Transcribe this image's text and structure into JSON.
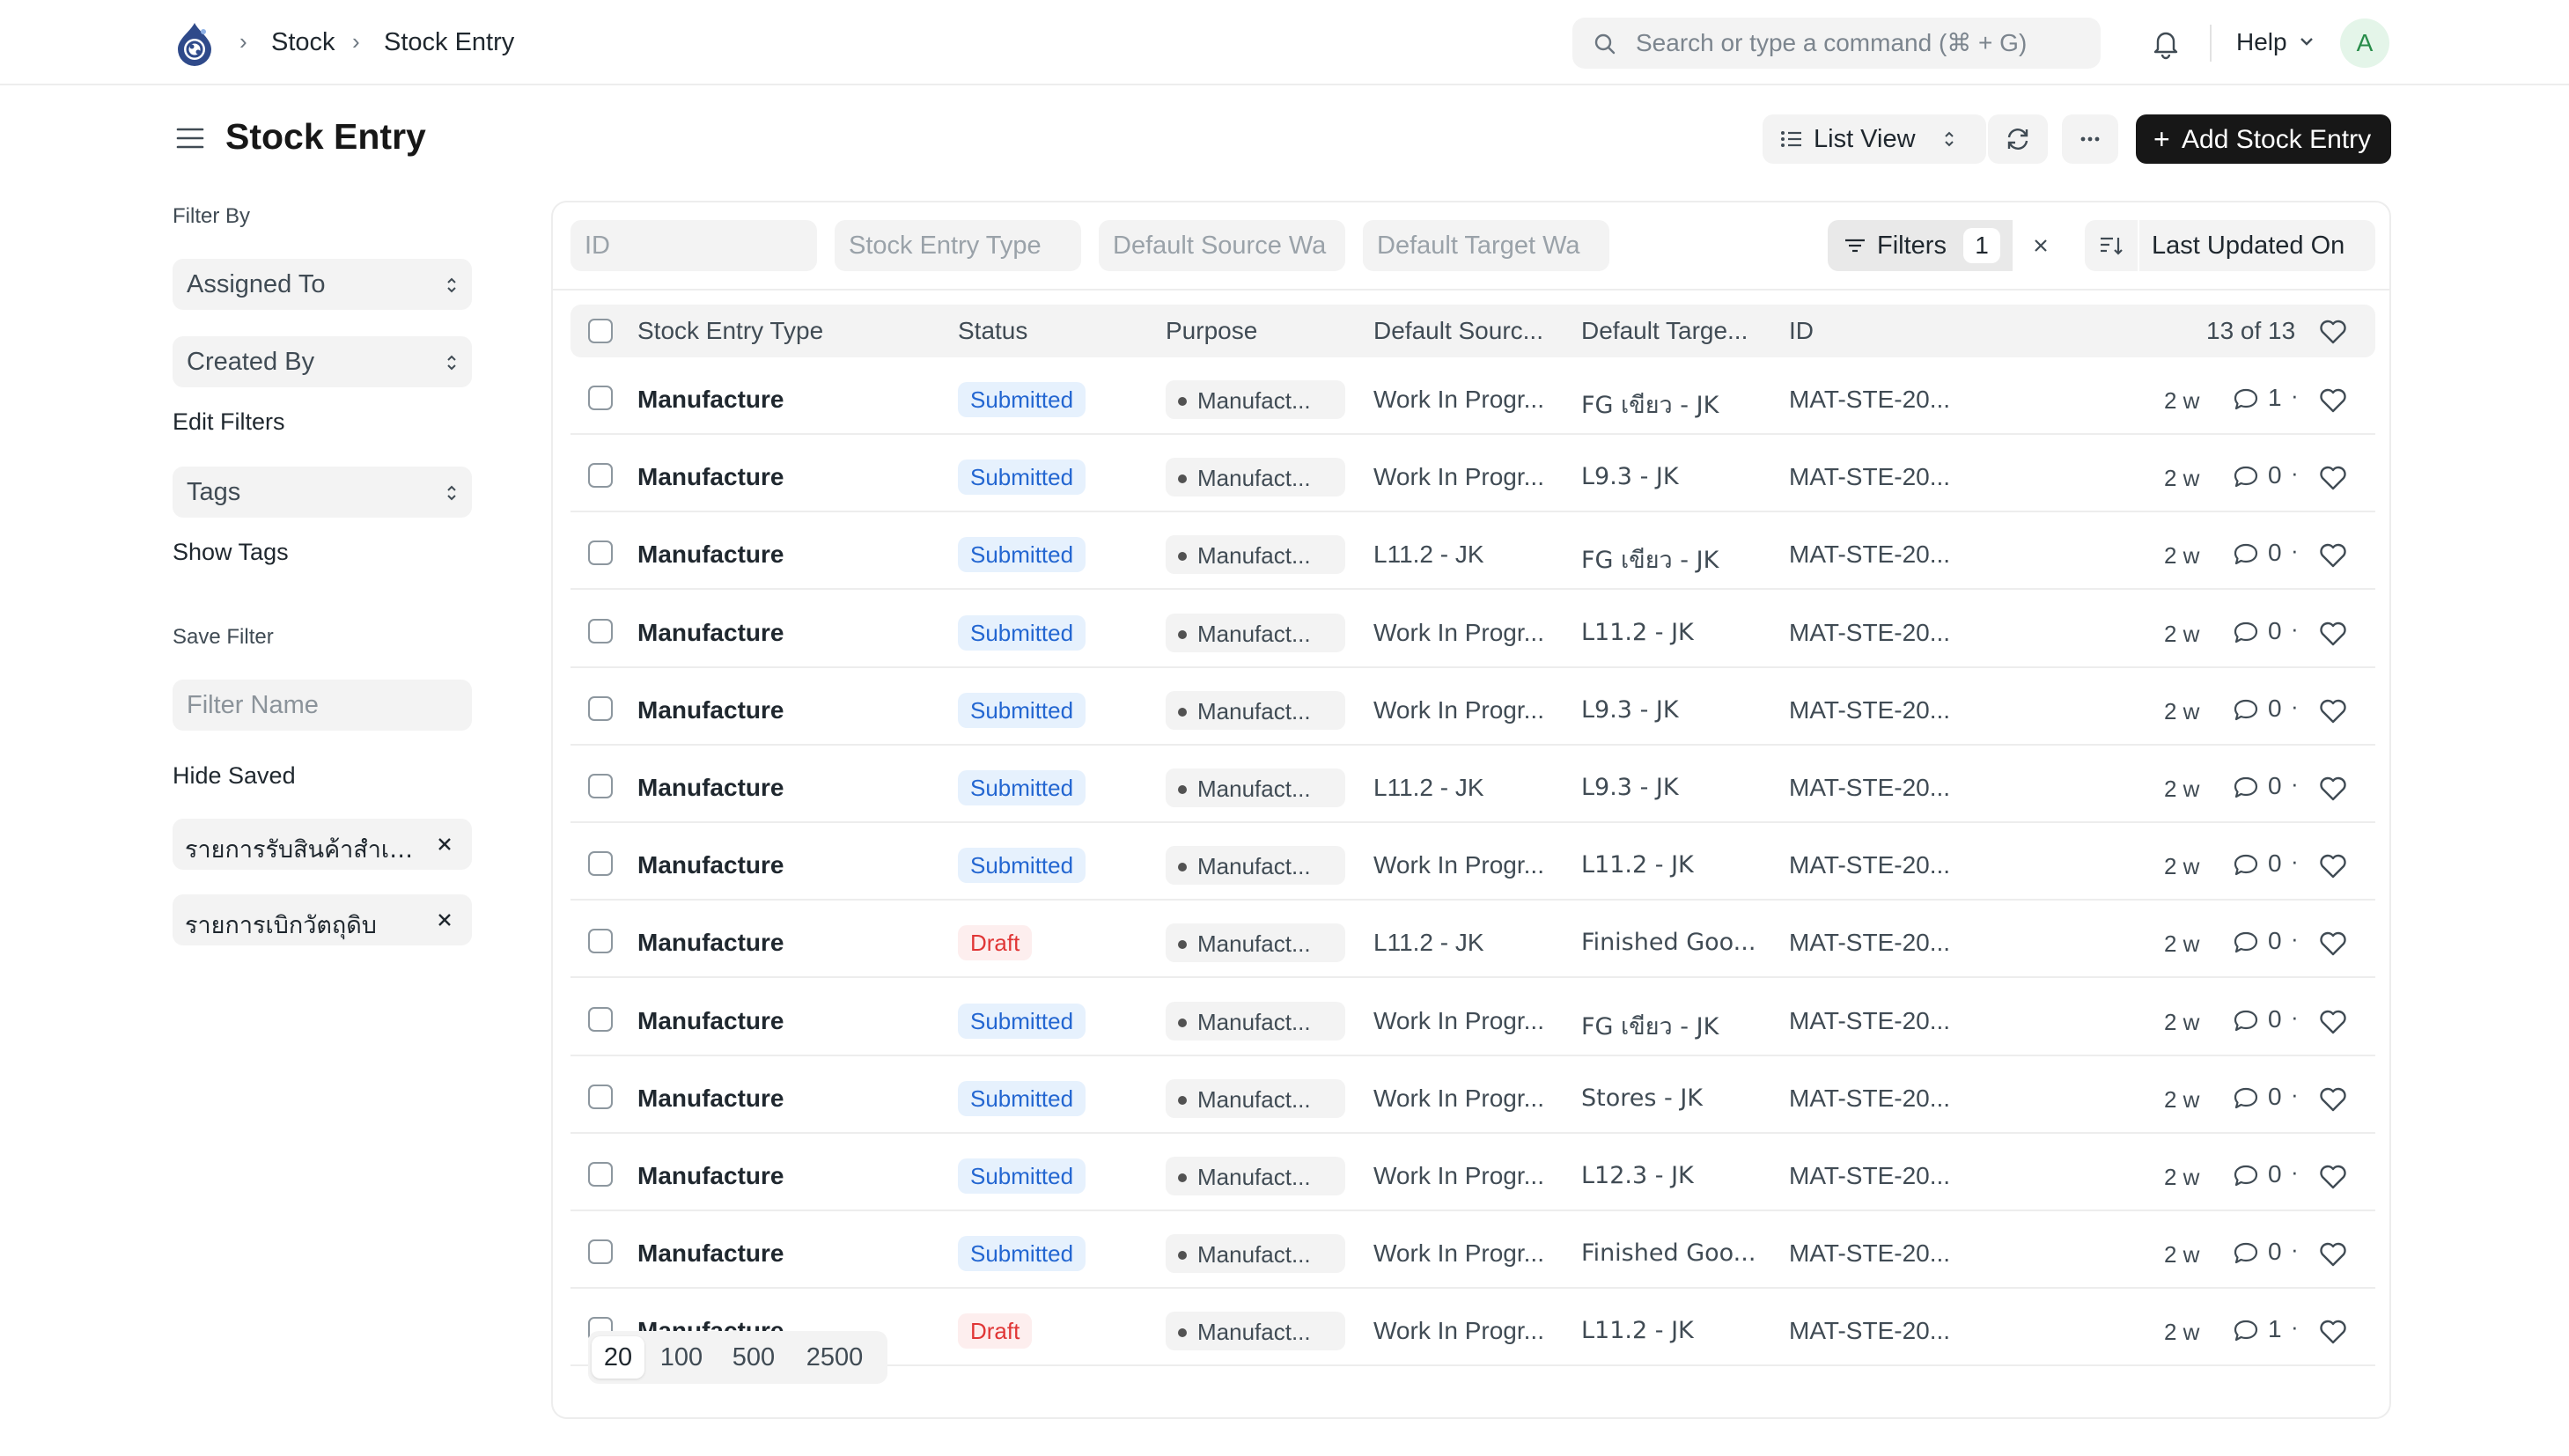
{
  "breadcrumb": {
    "items": [
      "Stock",
      "Stock Entry"
    ]
  },
  "search": {
    "placeholder": "Search or type a command (⌘ + G)"
  },
  "nav": {
    "help_label": "Help",
    "avatar_initial": "A"
  },
  "page": {
    "title": "Stock Entry",
    "view_label": "List View",
    "add_label": "Add Stock Entry"
  },
  "sidebar": {
    "filter_by_label": "Filter By",
    "assigned_to": "Assigned To",
    "created_by": "Created By",
    "edit_filters": "Edit Filters",
    "tags": "Tags",
    "show_tags": "Show Tags",
    "save_filter_label": "Save Filter",
    "filter_name_placeholder": "Filter Name",
    "hide_saved": "Hide Saved",
    "saved_filters": [
      "รายการรับสินค้าสำเร็จรูป",
      "รายการเบิกวัตถุดิบ"
    ]
  },
  "filters": {
    "id_placeholder": "ID",
    "type_placeholder": "Stock Entry Type",
    "source_placeholder": "Default Source Wa",
    "target_placeholder": "Default Target Wa",
    "filters_label": "Filters",
    "filters_count": "1",
    "sort_label": "Last Updated On"
  },
  "table": {
    "columns": {
      "type": "Stock Entry Type",
      "status": "Status",
      "purpose": "Purpose",
      "source": "Default Sourc...",
      "target": "Default Targe...",
      "id": "ID"
    },
    "count": "13 of 13",
    "rows": [
      {
        "type": "Manufacture",
        "status": "Submitted",
        "purpose": "Manufact...",
        "source": "Work In Progr...",
        "target": "FG เขียว - JK",
        "id": "MAT-STE-20...",
        "time": "2 w",
        "comments": "1"
      },
      {
        "type": "Manufacture",
        "status": "Submitted",
        "purpose": "Manufact...",
        "source": "Work In Progr...",
        "target": "L9.3 - JK",
        "id": "MAT-STE-20...",
        "time": "2 w",
        "comments": "0"
      },
      {
        "type": "Manufacture",
        "status": "Submitted",
        "purpose": "Manufact...",
        "source": "L11.2 - JK",
        "target": "FG เขียว - JK",
        "id": "MAT-STE-20...",
        "time": "2 w",
        "comments": "0"
      },
      {
        "type": "Manufacture",
        "status": "Submitted",
        "purpose": "Manufact...",
        "source": "Work In Progr...",
        "target": "L11.2 - JK",
        "id": "MAT-STE-20...",
        "time": "2 w",
        "comments": "0"
      },
      {
        "type": "Manufacture",
        "status": "Submitted",
        "purpose": "Manufact...",
        "source": "Work In Progr...",
        "target": "L9.3 - JK",
        "id": "MAT-STE-20...",
        "time": "2 w",
        "comments": "0"
      },
      {
        "type": "Manufacture",
        "status": "Submitted",
        "purpose": "Manufact...",
        "source": "L11.2 - JK",
        "target": "L9.3 - JK",
        "id": "MAT-STE-20...",
        "time": "2 w",
        "comments": "0"
      },
      {
        "type": "Manufacture",
        "status": "Submitted",
        "purpose": "Manufact...",
        "source": "Work In Progr...",
        "target": "L11.2 - JK",
        "id": "MAT-STE-20...",
        "time": "2 w",
        "comments": "0"
      },
      {
        "type": "Manufacture",
        "status": "Draft",
        "purpose": "Manufact...",
        "source": "L11.2 - JK",
        "target": "Finished Goo...",
        "id": "MAT-STE-20...",
        "time": "2 w",
        "comments": "0"
      },
      {
        "type": "Manufacture",
        "status": "Submitted",
        "purpose": "Manufact...",
        "source": "Work In Progr...",
        "target": "FG เขียว - JK",
        "id": "MAT-STE-20...",
        "time": "2 w",
        "comments": "0"
      },
      {
        "type": "Manufacture",
        "status": "Submitted",
        "purpose": "Manufact...",
        "source": "Work In Progr...",
        "target": "Stores - JK",
        "id": "MAT-STE-20...",
        "time": "2 w",
        "comments": "0"
      },
      {
        "type": "Manufacture",
        "status": "Submitted",
        "purpose": "Manufact...",
        "source": "Work In Progr...",
        "target": "L12.3 - JK",
        "id": "MAT-STE-20...",
        "time": "2 w",
        "comments": "0"
      },
      {
        "type": "Manufacture",
        "status": "Submitted",
        "purpose": "Manufact...",
        "source": "Work In Progr...",
        "target": "Finished Goo...",
        "id": "MAT-STE-20...",
        "time": "2 w",
        "comments": "0"
      },
      {
        "type": "Manufacture",
        "status": "Draft",
        "purpose": "Manufact...",
        "source": "Work In Progr...",
        "target": "L11.2 - JK",
        "id": "MAT-STE-20...",
        "time": "2 w",
        "comments": "1"
      }
    ]
  },
  "pagination": {
    "sizes": [
      "20",
      "100",
      "500",
      "2500"
    ],
    "active": "20"
  },
  "colors": {
    "accent": "#171717",
    "submitted": "#2366d1",
    "draft": "#e03636"
  }
}
